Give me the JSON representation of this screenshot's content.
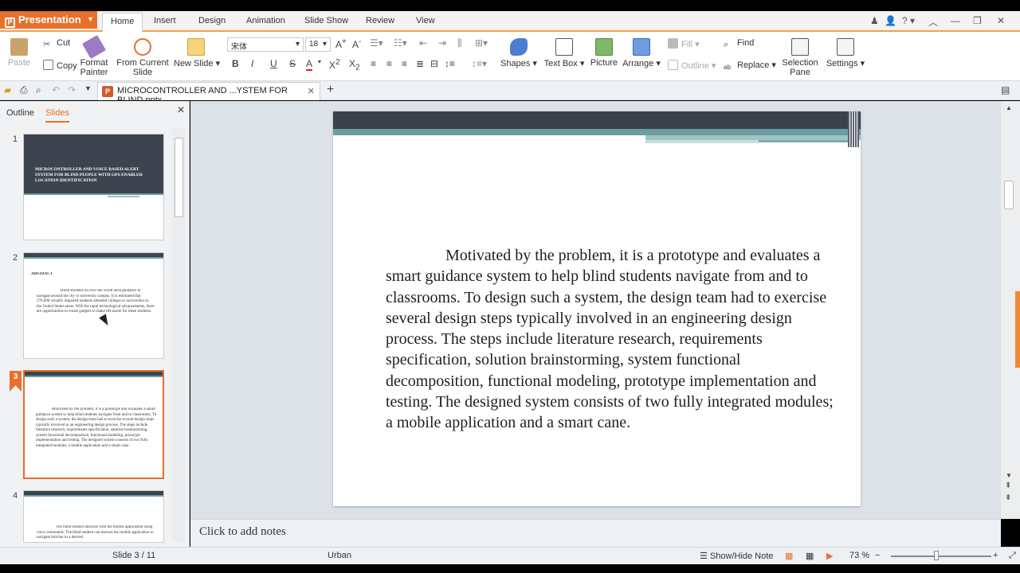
{
  "app": {
    "name": "Presentation"
  },
  "menu": {
    "tabs": [
      "Home",
      "Insert",
      "Design",
      "Animation",
      "Slide Show",
      "Review",
      "View"
    ],
    "active": "Home",
    "help": "?"
  },
  "ribbon": {
    "paste": "Paste",
    "cut": "Cut",
    "copy": "Copy",
    "format_painter": "Format Painter",
    "from_current_slide": "From Current Slide",
    "new_slide": "New Slide",
    "font_name": "宋体",
    "font_size": "18",
    "shapes": "Shapes",
    "text_box": "Text Box",
    "picture": "Picture",
    "arrange": "Arrange",
    "fill": "Fill",
    "outline": "Outline",
    "find": "Find",
    "replace": "Replace",
    "selection_pane": "Selection Pane",
    "settings": "Settings"
  },
  "document": {
    "tab_name": "MICROCONTROLLER AND ...YSTEM FOR BLIND.pptx"
  },
  "left_panel": {
    "tabs": [
      "Outline",
      "Slides"
    ],
    "active_tab": "Slides",
    "thumbnails": [
      {
        "num": "1",
        "title": "MICROCONTROLLER AND VOICE BASED ALERT SYSTEM FOR BLIND PEOPLE WITH GPS ENABLED LOCATION IDENTIFICATION"
      },
      {
        "num": "2",
        "heading": "ABSTRACT",
        "text": "Blind students all over the world need guidance to navigate around the city or university campus. It is estimated that 376,600 visually impaired students attended colleges or universities in the United States alone. With the rapid technological advancements, there are opportunities to create gadgets to make life easier for these students."
      },
      {
        "num": "3",
        "text": "Motivated by the problem, it is a prototype and evaluates a smart guidance system to help blind students navigate from and to classrooms. To design such a system, the design team had to exercise several design steps typically involved in an engineering design process. The steps include literature research, requirements specification, solution brainstorming, system functional decomposition, functional modeling, prototype implementation and testing. The designed system consists of two fully integrated modules; a mobile application and a smart cane."
      },
      {
        "num": "4",
        "text": "The blind student interacts with the mobile application using voice commands. The blind student can instruct the mobile application to navigate him/her to a desired"
      }
    ]
  },
  "slide": {
    "body": "Motivated by the problem, it is a prototype and evaluates a smart guidance system to help blind students navigate from and to classrooms. To design such a system, the design team had to exercise several design steps typically involved in an engineering design process. The steps include literature research, requirements specification, solution brainstorming, system functional decomposition, functional modeling, prototype implementation and testing. The designed system consists of two fully integrated modules; a mobile application and a smart cane."
  },
  "notes": {
    "placeholder": "Click to add notes"
  },
  "status": {
    "slide_info": "Slide 3 / 11",
    "theme": "Urban",
    "show_hide_note": "Show/Hide Note",
    "zoom": "73 %",
    "zoom_fraction": 0.45
  },
  "colors": {
    "accent": "#e8702a",
    "slide_bar": "#3b414c",
    "slide_band": "#6a9ea0"
  }
}
